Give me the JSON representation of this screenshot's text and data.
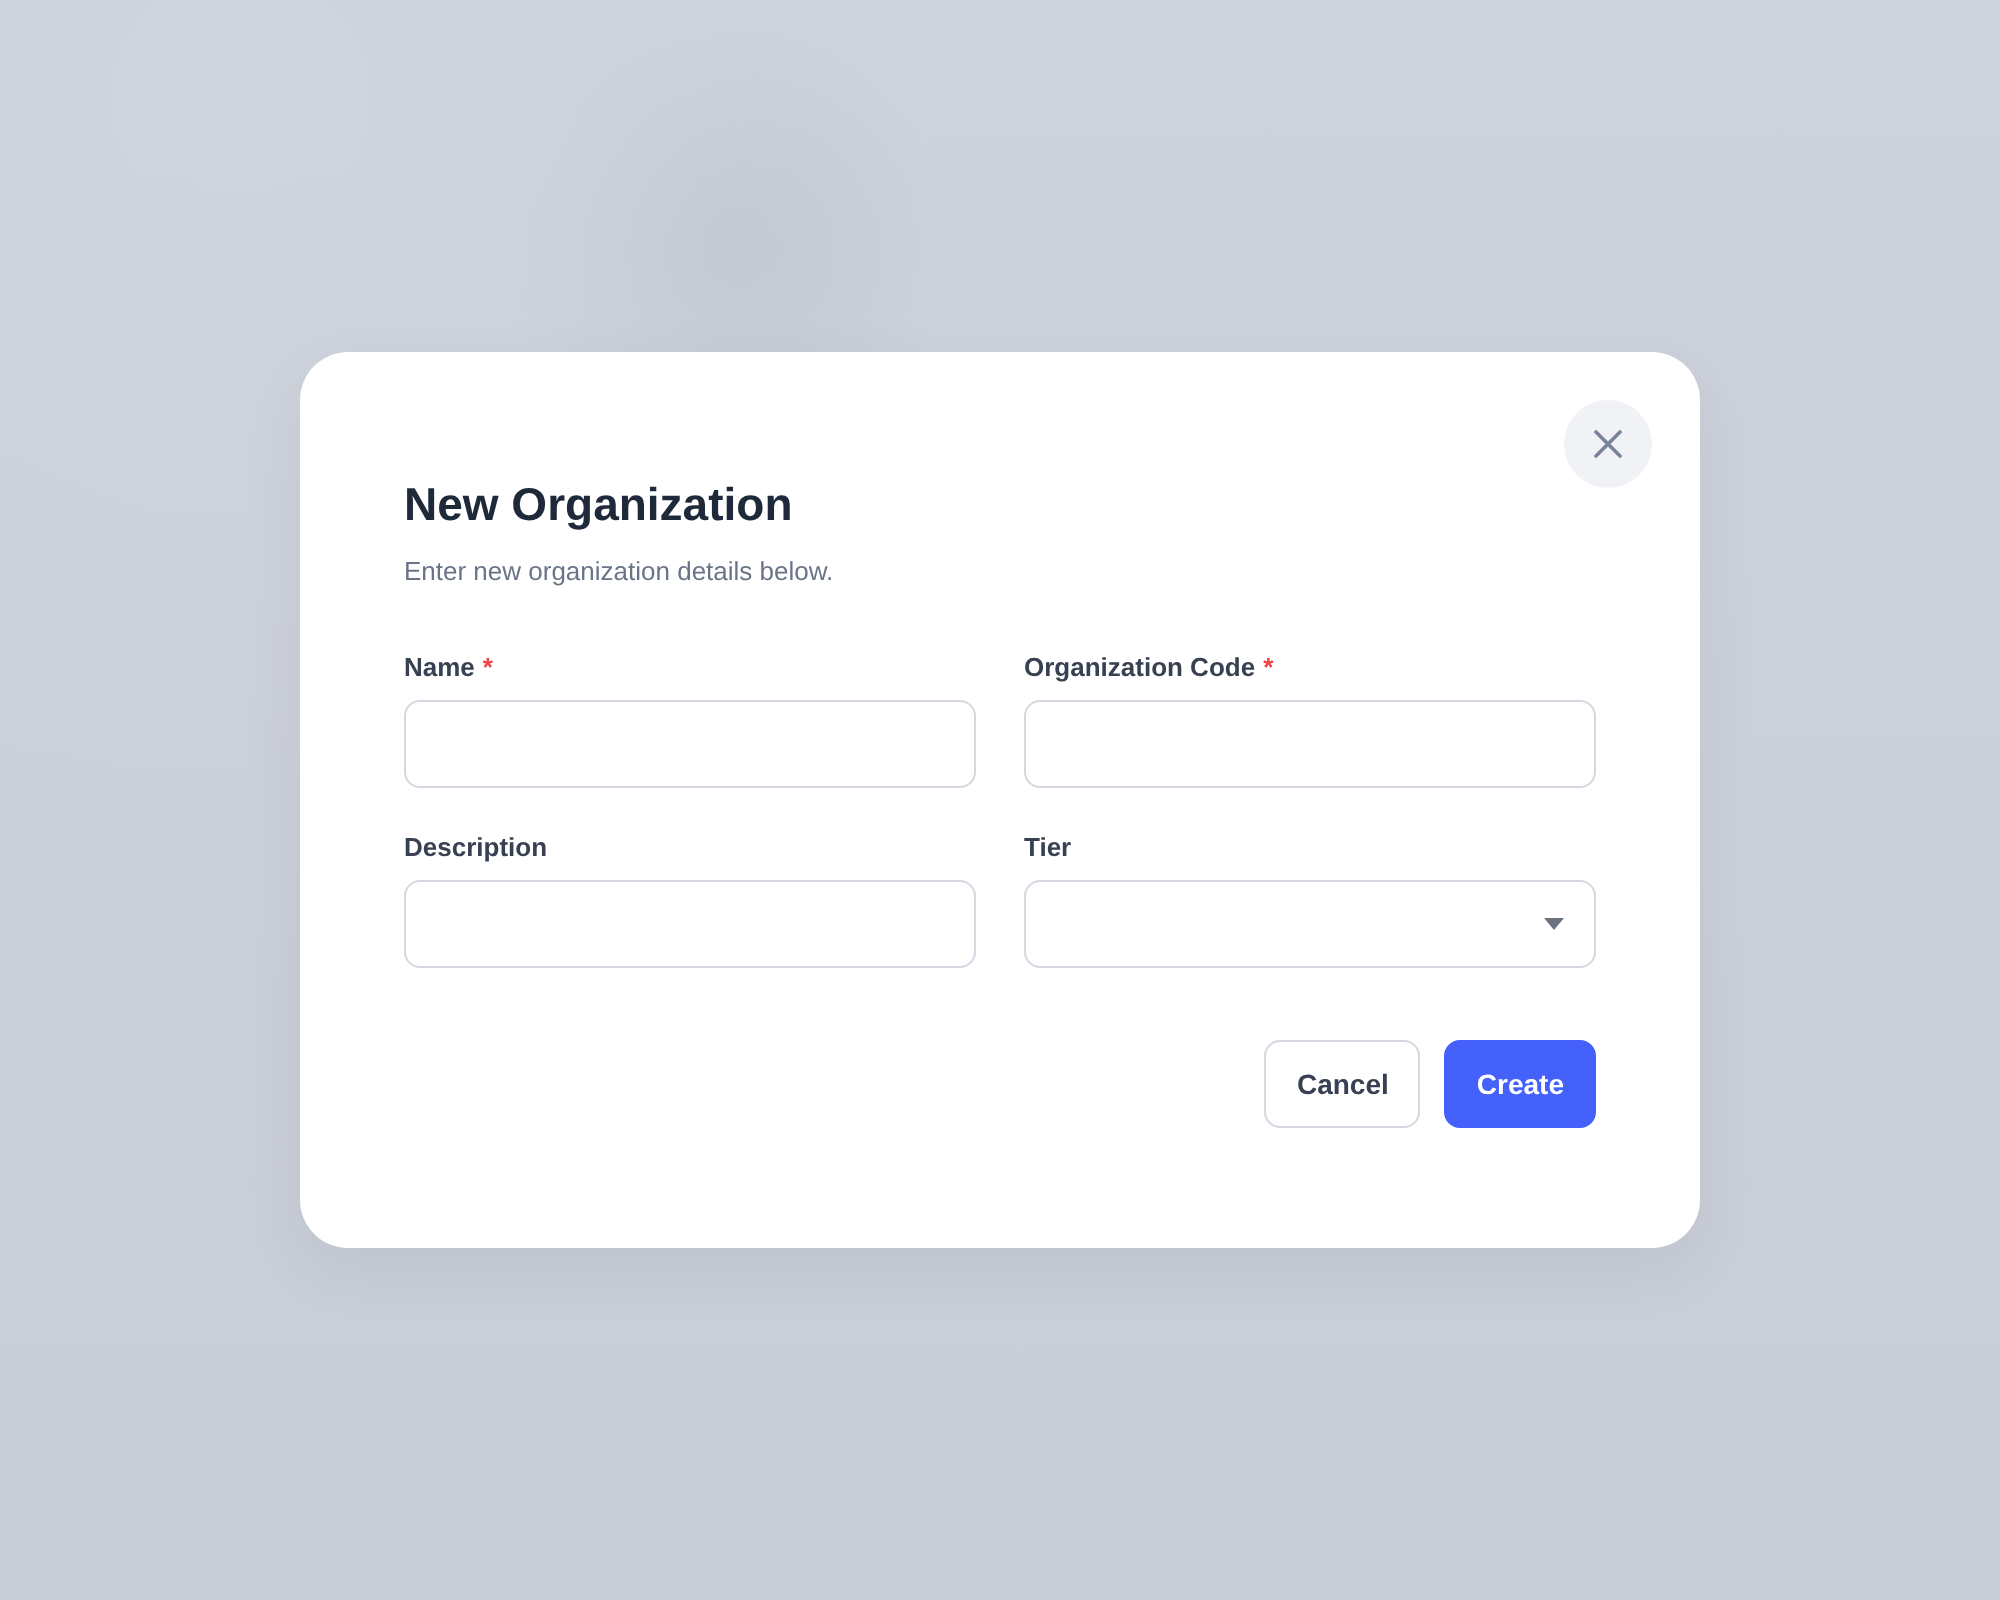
{
  "dialog": {
    "title": "New Organization",
    "subtitle": "Enter new organization details below.",
    "fields": [
      {
        "label": "Name",
        "required_marker": "*",
        "kind": "text"
      },
      {
        "label": "Organization Code",
        "required_marker": "*",
        "kind": "text"
      },
      {
        "label": "Description",
        "kind": "text"
      },
      {
        "label": "Tier",
        "kind": "select"
      }
    ],
    "buttons": [
      {
        "label": "Cancel",
        "kind": "secondary"
      },
      {
        "label": "Create",
        "kind": "primary"
      }
    ]
  }
}
